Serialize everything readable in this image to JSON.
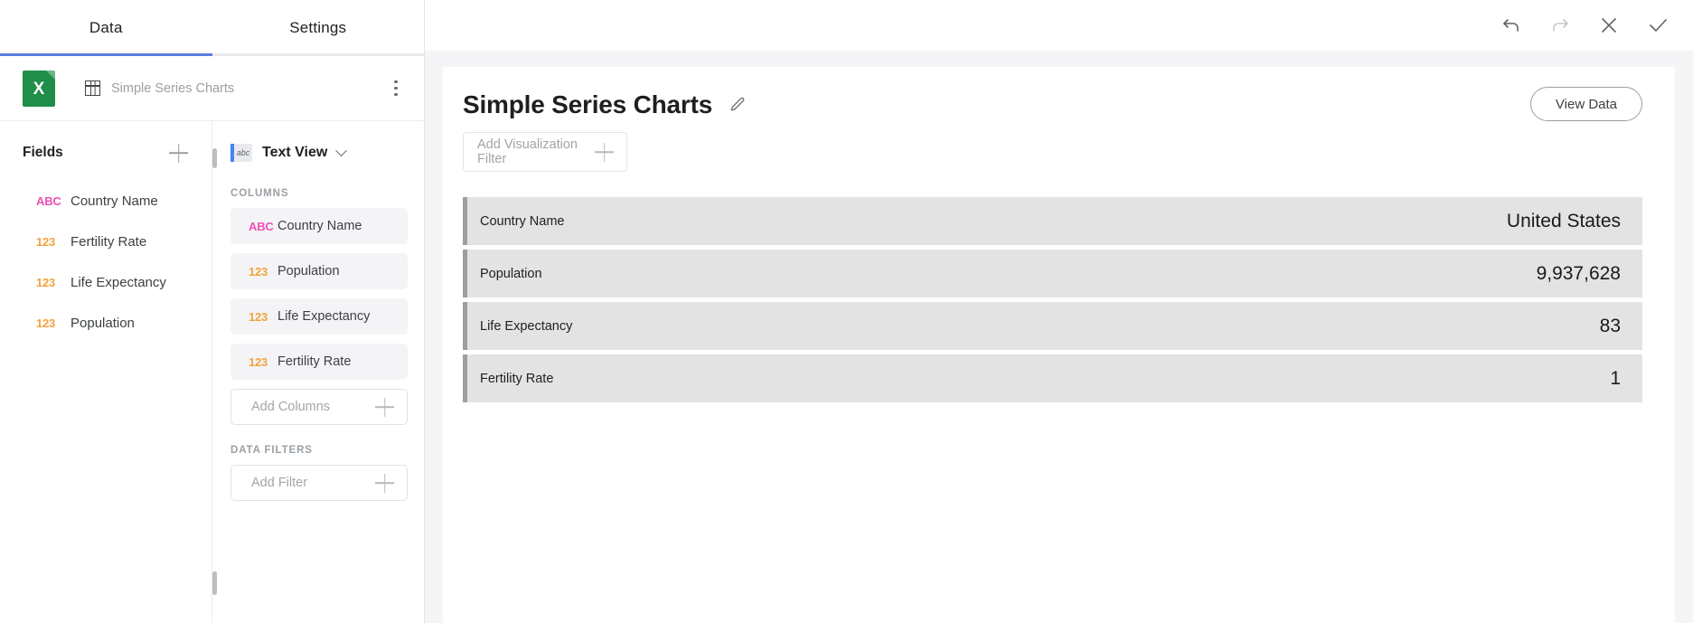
{
  "tabs": [
    {
      "label": "Data",
      "active": true
    },
    {
      "label": "Settings",
      "active": false
    }
  ],
  "dataset": {
    "name": "Simple Series Charts",
    "source_icon": "excel-icon",
    "table_icon": "table-grid-icon",
    "menu_icon": "kebab-menu-icon"
  },
  "fields": {
    "title": "Fields",
    "add_icon": "plus-icon",
    "items": [
      {
        "type": "ABC",
        "label": "Country Name"
      },
      {
        "type": "123",
        "label": "Fertility Rate"
      },
      {
        "type": "123",
        "label": "Life Expectancy"
      },
      {
        "type": "123",
        "label": "Population"
      }
    ]
  },
  "viz_config": {
    "view_type": "Text View",
    "view_type_icon": "text-view-icon",
    "chevron_icon": "chevron-down-icon",
    "columns_heading": "COLUMNS",
    "columns": [
      {
        "type": "ABC",
        "label": "Country Name"
      },
      {
        "type": "123",
        "label": "Population"
      },
      {
        "type": "123",
        "label": "Life Expectancy"
      },
      {
        "type": "123",
        "label": "Fertility Rate"
      }
    ],
    "add_columns_label": "Add Columns",
    "data_filters_heading": "DATA FILTERS",
    "add_filter_label": "Add Filter"
  },
  "toolbar": {
    "undo_icon": "undo-arrow-icon",
    "redo_icon": "redo-arrow-icon",
    "close_icon": "close-x-icon",
    "confirm_icon": "checkmark-icon"
  },
  "visualization": {
    "title": "Simple Series Charts",
    "edit_icon": "pencil-edit-icon",
    "view_data_label": "View Data",
    "add_filter_label": "Add Visualization Filter",
    "add_filter_icon": "plus-icon"
  },
  "colors": {
    "accent": "#5b7fe0",
    "excel_green": "#1e8e49",
    "type_text": "#ef4fb4",
    "type_number": "#f2a33c",
    "row_bg": "#e3e3e3",
    "row_accent": "#9e9e9e"
  },
  "chart_data": {
    "type": "table",
    "title": "Simple Series Charts",
    "categories": [
      "Country Name",
      "Population",
      "Life Expectancy",
      "Fertility Rate"
    ],
    "rows": [
      {
        "label": "Country Name",
        "value": "United States"
      },
      {
        "label": "Population",
        "value": "9,937,628"
      },
      {
        "label": "Life Expectancy",
        "value": "83"
      },
      {
        "label": "Fertility Rate",
        "value": "1"
      }
    ]
  }
}
